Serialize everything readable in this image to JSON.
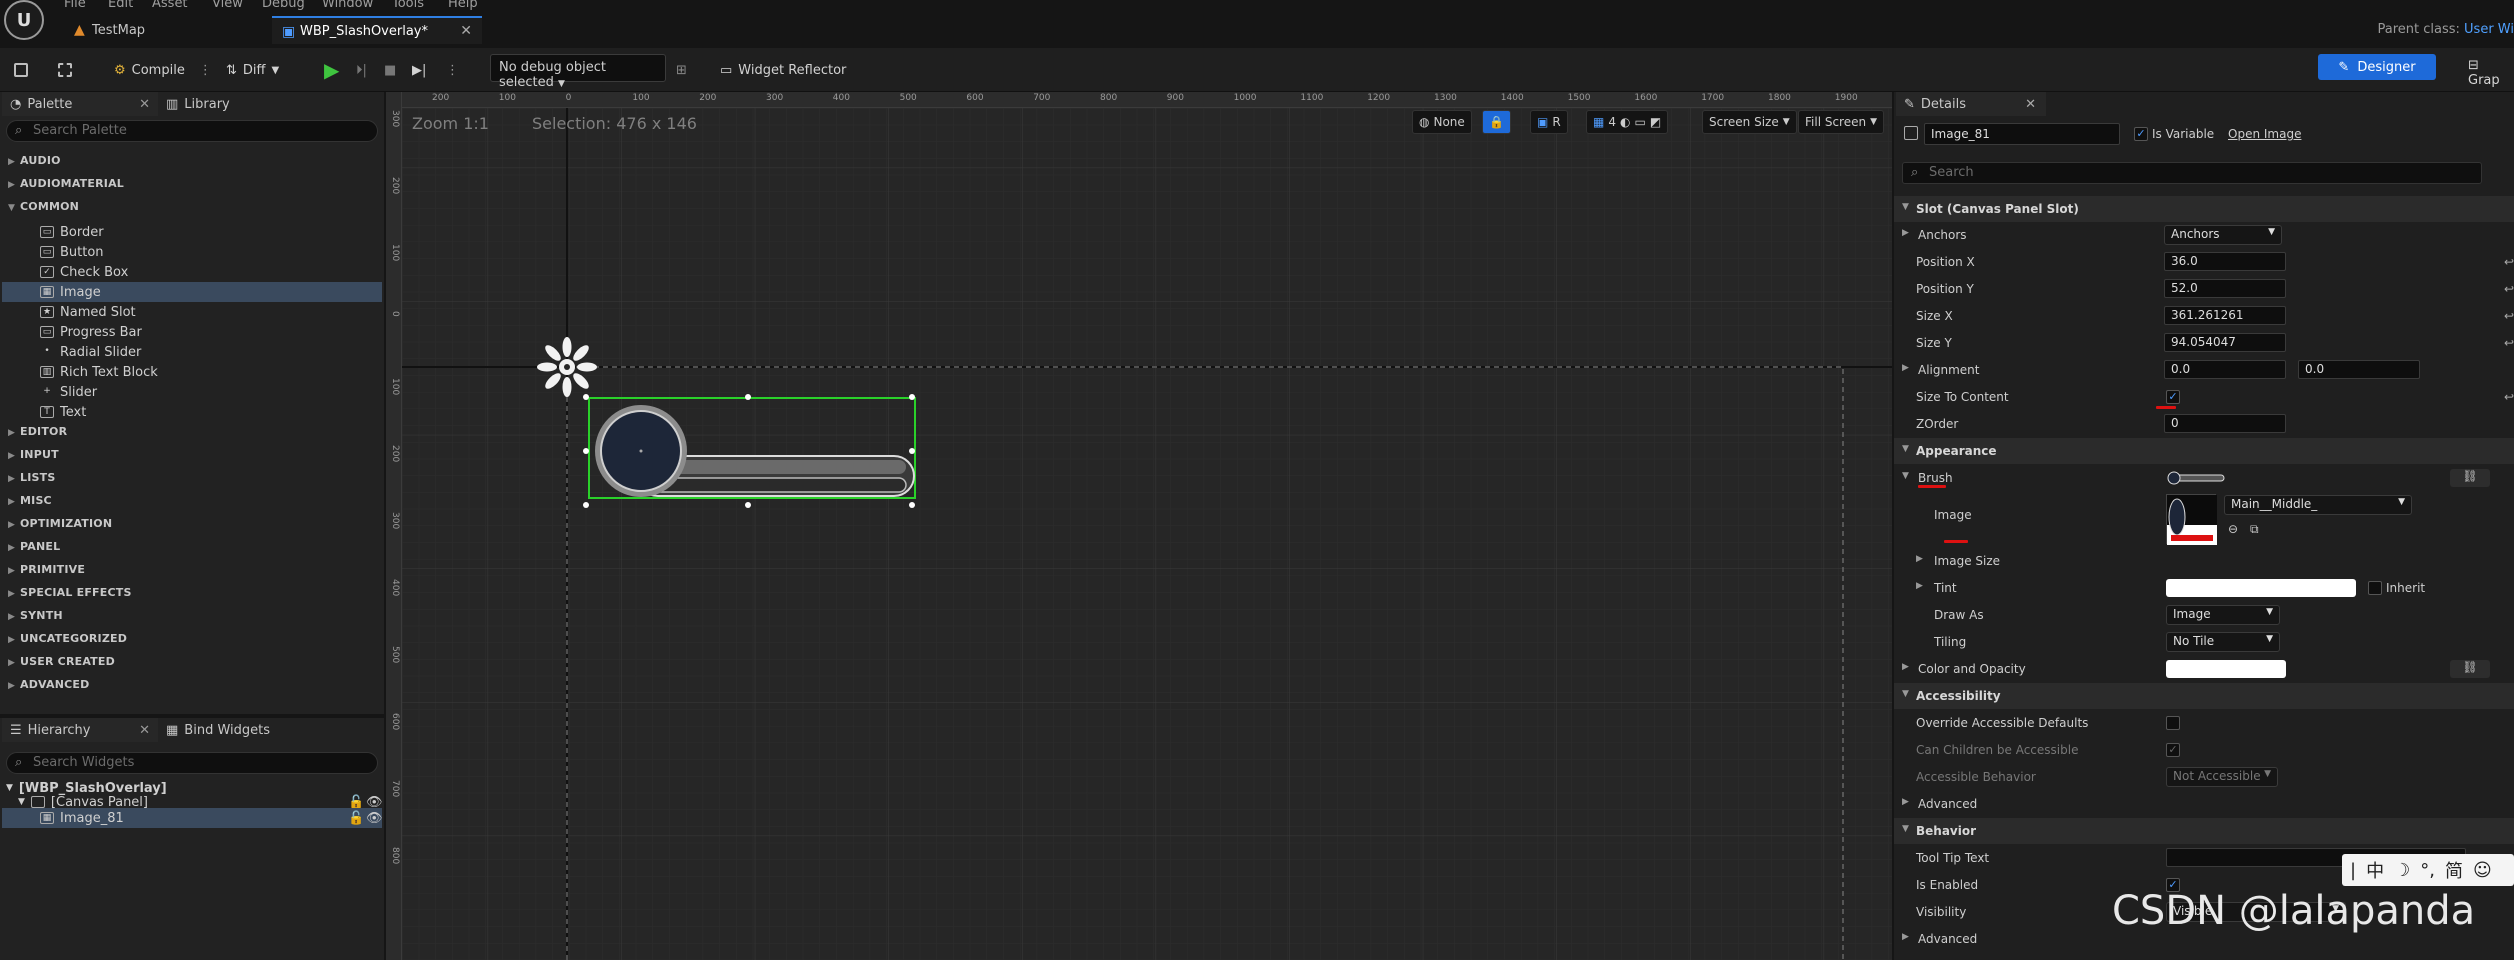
{
  "menu": [
    "File",
    "Edit",
    "Asset",
    "View",
    "Debug",
    "Window",
    "Tools",
    "Help"
  ],
  "tabs": [
    {
      "label": "TestMap"
    },
    {
      "label": "WBP_SlashOverlay*"
    }
  ],
  "parent_class": {
    "label": "Parent class:",
    "value": "User Wi"
  },
  "toolbar": {
    "compile": "Compile",
    "diff": "Diff",
    "debug_object": "No debug object selected",
    "widget_reflector": "Widget Reflector",
    "designer": "Designer",
    "graph": "Grap"
  },
  "palette": {
    "tab": "Palette",
    "library_tab": "Library",
    "search_placeholder": "Search Palette",
    "categories_top": [
      "AUDIO",
      "AUDIOMATERIAL",
      "COMMON"
    ],
    "common_items": [
      "Border",
      "Button",
      "Check Box",
      "Image",
      "Named Slot",
      "Progress Bar",
      "Radial Slider",
      "Rich Text Block",
      "Slider",
      "Text"
    ],
    "categories_bottom": [
      "EDITOR",
      "INPUT",
      "LISTS",
      "MISC",
      "OPTIMIZATION",
      "PANEL",
      "PRIMITIVE",
      "SPECIAL EFFECTS",
      "SYNTH",
      "UNCATEGORIZED",
      "USER CREATED",
      "ADVANCED"
    ]
  },
  "hierarchy": {
    "tab": "Hierarchy",
    "bind_tab": "Bind Widgets",
    "search_placeholder": "Search Widgets",
    "root": "[WBP_SlashOverlay]",
    "panel": "[Canvas Panel]",
    "child": "Image_81"
  },
  "canvas": {
    "zoom": "Zoom 1:1",
    "selection": "Selection: 476 x 146",
    "ruler_top": [
      "200",
      "100",
      "0",
      "100",
      "200",
      "300",
      "400",
      "500",
      "600",
      "700",
      "800",
      "900",
      "1000",
      "1100",
      "1200",
      "1300",
      "1400",
      "1500",
      "1600",
      "1700",
      "1800",
      "1900"
    ],
    "ruler_left": [
      "300",
      "200",
      "100",
      "0",
      "100",
      "200",
      "300",
      "400",
      "500",
      "600",
      "700",
      "800"
    ],
    "buttons": {
      "none": "None",
      "r": "R",
      "grid": "4",
      "screen_size": "Screen Size",
      "fill_screen": "Fill Screen"
    }
  },
  "details": {
    "tab": "Details",
    "name": "Image_81",
    "is_variable": "Is Variable",
    "open_image": "Open Image",
    "search_placeholder": "Search",
    "slot_section": "Slot (Canvas Panel Slot)",
    "anchors_label": "Anchors",
    "anchors_value": "Anchors",
    "position_x_label": "Position X",
    "position_x": "36.0",
    "position_y_label": "Position Y",
    "position_y": "52.0",
    "size_x_label": "Size X",
    "size_x": "361.261261",
    "size_y_label": "Size Y",
    "size_y": "94.054047",
    "alignment_label": "Alignment",
    "alignment_x": "0.0",
    "alignment_y": "0.0",
    "size_to_content": "Size To Content",
    "zorder_label": "ZOrder",
    "zorder": "0",
    "appearance": "Appearance",
    "brush": "Brush",
    "image_label": "Image",
    "image_asset": "Main__Middle_",
    "image_size": "Image Size",
    "tint": "Tint",
    "inherit": "Inherit",
    "draw_as_label": "Draw As",
    "draw_as": "Image",
    "tiling_label": "Tiling",
    "tiling": "No Tile",
    "color_opacity": "Color and Opacity",
    "accessibility": "Accessibility",
    "override_access": "Override Accessible Defaults",
    "children_access": "Can Children be Accessible",
    "access_behavior": "Accessible Behavior",
    "access_behavior_value": "Not Accessible",
    "advanced": "Advanced",
    "behavior": "Behavior",
    "tooltip": "Tool Tip Text",
    "is_enabled": "Is Enabled",
    "visibility": "Visibility",
    "visibility_value": "Visible",
    "advanced2": "Advanced"
  },
  "ime": [
    "中",
    "☽",
    "°,",
    "简",
    "☺"
  ],
  "watermark": "CSDN @lalapanda"
}
